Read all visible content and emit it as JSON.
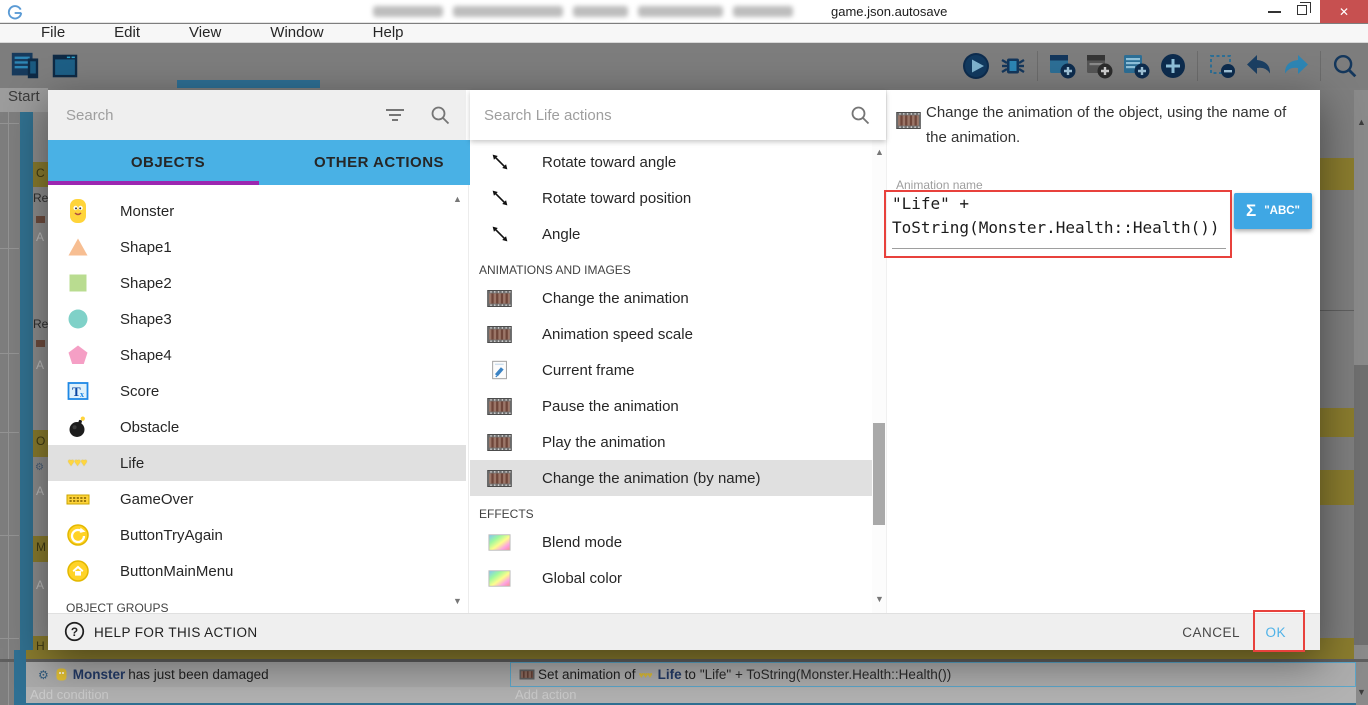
{
  "window": {
    "title": "game.json.autosave",
    "minimize_glyph": "–",
    "close_glyph": "✕"
  },
  "menu_bar": [
    "File",
    "Edit",
    "View",
    "Window",
    "Help"
  ],
  "toolbar": {
    "left_icons": [
      "project-manager",
      "scene-editor"
    ],
    "right_icons": [
      "play",
      "debug",
      "|",
      "add-object",
      "add-external-events",
      "add-comment",
      "add-event",
      "|",
      "remove-instance",
      "undo",
      "redo",
      "|",
      "search"
    ]
  },
  "scene_tab_label": "Start",
  "background_fragments": [
    "C",
    "Re",
    "A",
    "Re",
    "A",
    "O",
    "A",
    "M",
    "A",
    "H"
  ],
  "dialog": {
    "object_panel": {
      "search_placeholder": "Search",
      "tabs": [
        {
          "label": "OBJECTS",
          "active": true
        },
        {
          "label": "OTHER ACTIONS",
          "active": false
        }
      ],
      "objects": [
        {
          "label": "Monster",
          "icon": "monster"
        },
        {
          "label": "Shape1",
          "icon": "triangle"
        },
        {
          "label": "Shape2",
          "icon": "square"
        },
        {
          "label": "Shape3",
          "icon": "circle"
        },
        {
          "label": "Shape4",
          "icon": "pentagon"
        },
        {
          "label": "Score",
          "icon": "text-object"
        },
        {
          "label": "Obstacle",
          "icon": "bomb"
        },
        {
          "label": "Life",
          "icon": "hearts",
          "selected": true
        },
        {
          "label": "GameOver",
          "icon": "banner"
        },
        {
          "label": "ButtonTryAgain",
          "icon": "retry-button"
        },
        {
          "label": "ButtonMainMenu",
          "icon": "home-button"
        }
      ],
      "groups_header": "OBJECT GROUPS"
    },
    "action_panel": {
      "search_placeholder": "Search Life actions",
      "items": [
        {
          "label": "Rotate toward angle",
          "icon": "rotate"
        },
        {
          "label": "Rotate toward position",
          "icon": "rotate"
        },
        {
          "label": "Angle",
          "icon": "rotate"
        },
        {
          "header": "ANIMATIONS AND IMAGES"
        },
        {
          "label": "Change the animation",
          "icon": "film"
        },
        {
          "label": "Animation speed scale",
          "icon": "film"
        },
        {
          "label": "Current frame",
          "icon": "frame"
        },
        {
          "label": "Pause the animation",
          "icon": "film"
        },
        {
          "label": "Play the animation",
          "icon": "film"
        },
        {
          "label": "Change the animation (by name)",
          "icon": "film",
          "selected": true
        },
        {
          "header": "EFFECTS"
        },
        {
          "label": "Blend mode",
          "icon": "effect"
        },
        {
          "label": "Global color",
          "icon": "effect"
        }
      ]
    },
    "detail_panel": {
      "description": "Change the animation of the object, using the name of the animation.",
      "field_label": "Animation name",
      "field_line1": "\"Life\" +",
      "field_line2": "ToString(Monster.Health::Health())",
      "expression_button": {
        "sigma": "Σ",
        "label": "\"ABC\""
      }
    },
    "footer": {
      "help_label": "HELP FOR THIS ACTION",
      "cancel_label": "CANCEL",
      "ok_label": "OK"
    }
  },
  "events_sheet": {
    "condition_object": "Monster",
    "condition_rest": "has just been damaged",
    "action_prefix": "Set animation of",
    "action_object": "Life",
    "action_mid": "to",
    "action_expression": "\"Life\" + ToString(Monster.Health::Health())",
    "add_condition": "Add condition",
    "add_action": "Add action"
  },
  "colors": {
    "accent_blue": "#49B1E5",
    "tab_underline_purple": "#9C27B0",
    "annotation_red": "#E8413C",
    "ok_blue": "#4FB2E8",
    "close_red": "#C75050"
  }
}
